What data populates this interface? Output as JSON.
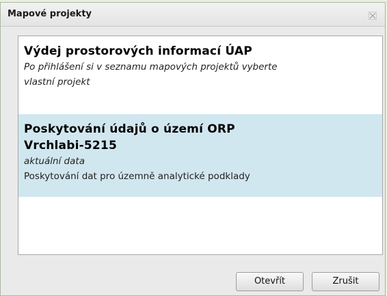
{
  "dialog": {
    "title": "Mapové projekty",
    "close_icon": "close-icon"
  },
  "projects": [
    {
      "title": "Výdej prostorových informací ÚAP",
      "subtitle_lines": [
        "Po přihlášení si v seznamu mapových projektů vyberte",
        "vlastní projekt"
      ],
      "selected": false
    },
    {
      "title_lines": [
        "Poskytování údajů o území ORP",
        "Vrchlabi-5215"
      ],
      "subtitle": "aktuální data",
      "description": "Poskytování dat pro územně analytické podklady",
      "selected": true
    }
  ],
  "buttons": {
    "open_label": "Otevřít",
    "cancel_label": "Zrušit"
  },
  "colors": {
    "selected_row": "#d1e7ef",
    "background": "#e9f1dd"
  }
}
